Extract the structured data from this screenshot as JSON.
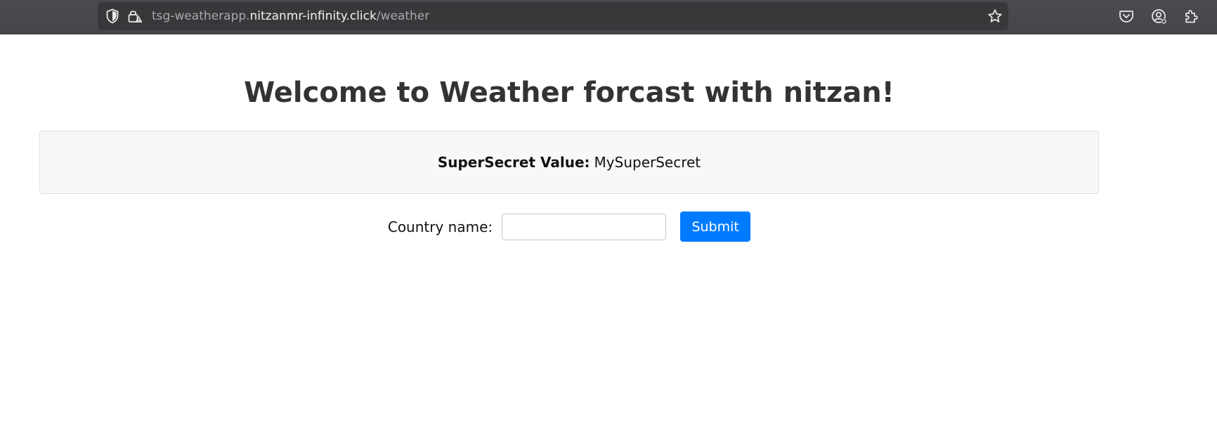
{
  "browser": {
    "url_prefix": "tsg-weatherapp.",
    "url_host": "nitzanmr-infinity.click",
    "url_path": "/weather",
    "icons": [
      "shield-icon",
      "lock-warning-icon",
      "bookmark-star-icon",
      "pocket-icon",
      "account-icon",
      "extensions-icon"
    ]
  },
  "page": {
    "title": "Welcome to Weather forcast with nitzan!",
    "secret_label": "SuperSecret Value:",
    "secret_value": "MySuperSecret",
    "form": {
      "country_label": "Country name:",
      "country_value": "",
      "submit_label": "Submit"
    }
  },
  "colors": {
    "toolbar": "#4a4a4f",
    "urlbar": "#38383b",
    "submit_button": "#007bff",
    "secret_box_bg": "#f7f8f9"
  }
}
